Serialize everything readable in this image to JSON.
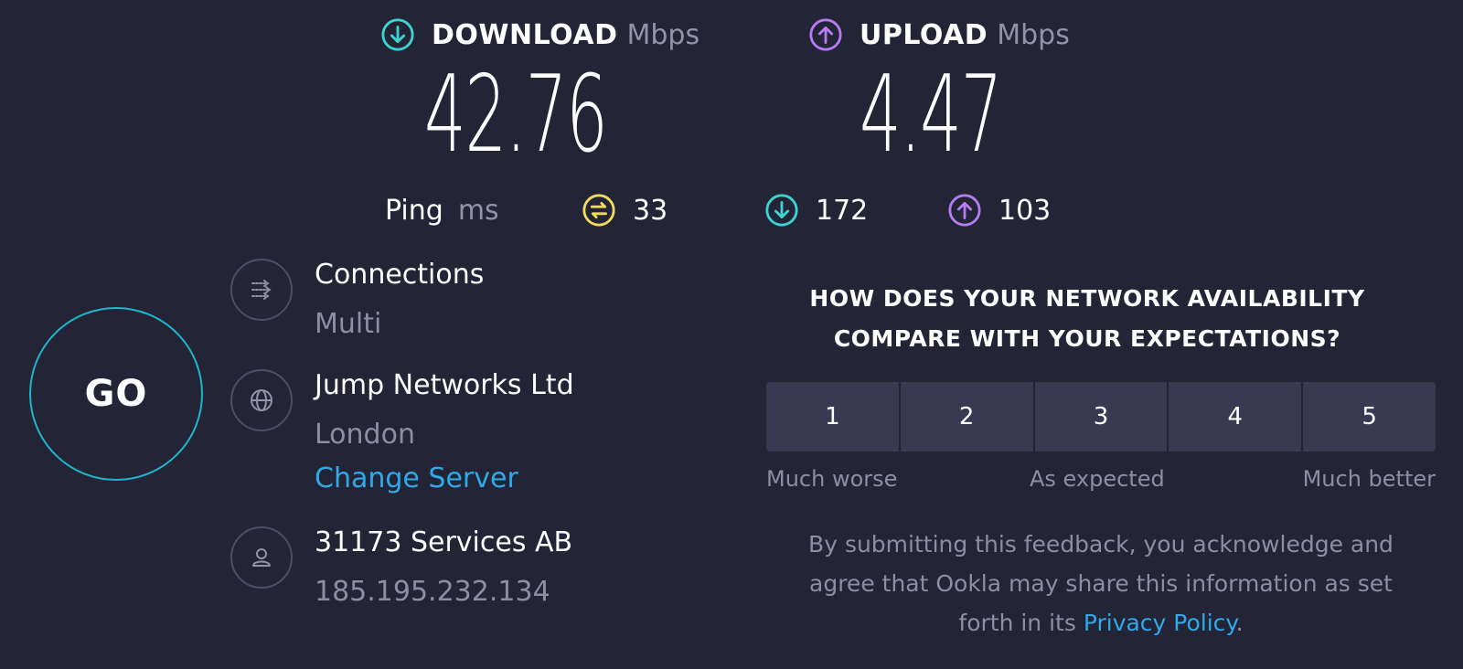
{
  "results": {
    "download": {
      "label": "DOWNLOAD",
      "unit": "Mbps",
      "value": "42.76",
      "icon": "download-arrow-icon",
      "color": "#3ed2d2"
    },
    "upload": {
      "label": "UPLOAD",
      "unit": "Mbps",
      "value": "4.47",
      "icon": "upload-arrow-icon",
      "color": "#b47cf0"
    }
  },
  "ping": {
    "label": "Ping",
    "unit": "ms",
    "idle": {
      "value": "33",
      "icon": "ping-idle-icon",
      "color": "#f0d95c"
    },
    "download": {
      "value": "172",
      "icon": "ping-download-icon",
      "color": "#3ed2d2"
    },
    "upload": {
      "value": "103",
      "icon": "ping-upload-icon",
      "color": "#b47cf0"
    }
  },
  "go_button": {
    "label": "GO",
    "color": "#1fb6cc"
  },
  "info": {
    "connections": {
      "title": "Connections",
      "value": "Multi",
      "icon": "connections-icon"
    },
    "server": {
      "name": "Jump Networks Ltd",
      "location": "London",
      "change_label": "Change Server",
      "icon": "globe-icon"
    },
    "provider": {
      "name": "31173 Services AB",
      "ip": "185.195.232.134",
      "icon": "user-icon"
    }
  },
  "survey": {
    "question_line1": "HOW DOES YOUR NETWORK AVAILABILITY",
    "question_line2": "COMPARE WITH YOUR EXPECTATIONS?",
    "ratings": [
      "1",
      "2",
      "3",
      "4",
      "5"
    ],
    "label_low": "Much worse",
    "label_mid": "As expected",
    "label_high": "Much better",
    "disclaimer_line1": "By submitting this feedback, you acknowledge and",
    "disclaimer_line2": "agree that Ookla may share this information as set",
    "disclaimer_line3_prefix": "forth in its ",
    "privacy_link": "Privacy Policy",
    "disclaimer_suffix": "."
  },
  "colors": {
    "background": "#232436",
    "muted_text": "#8c8ea3",
    "link": "#2fa9e8",
    "rating_bg": "#393a51"
  }
}
